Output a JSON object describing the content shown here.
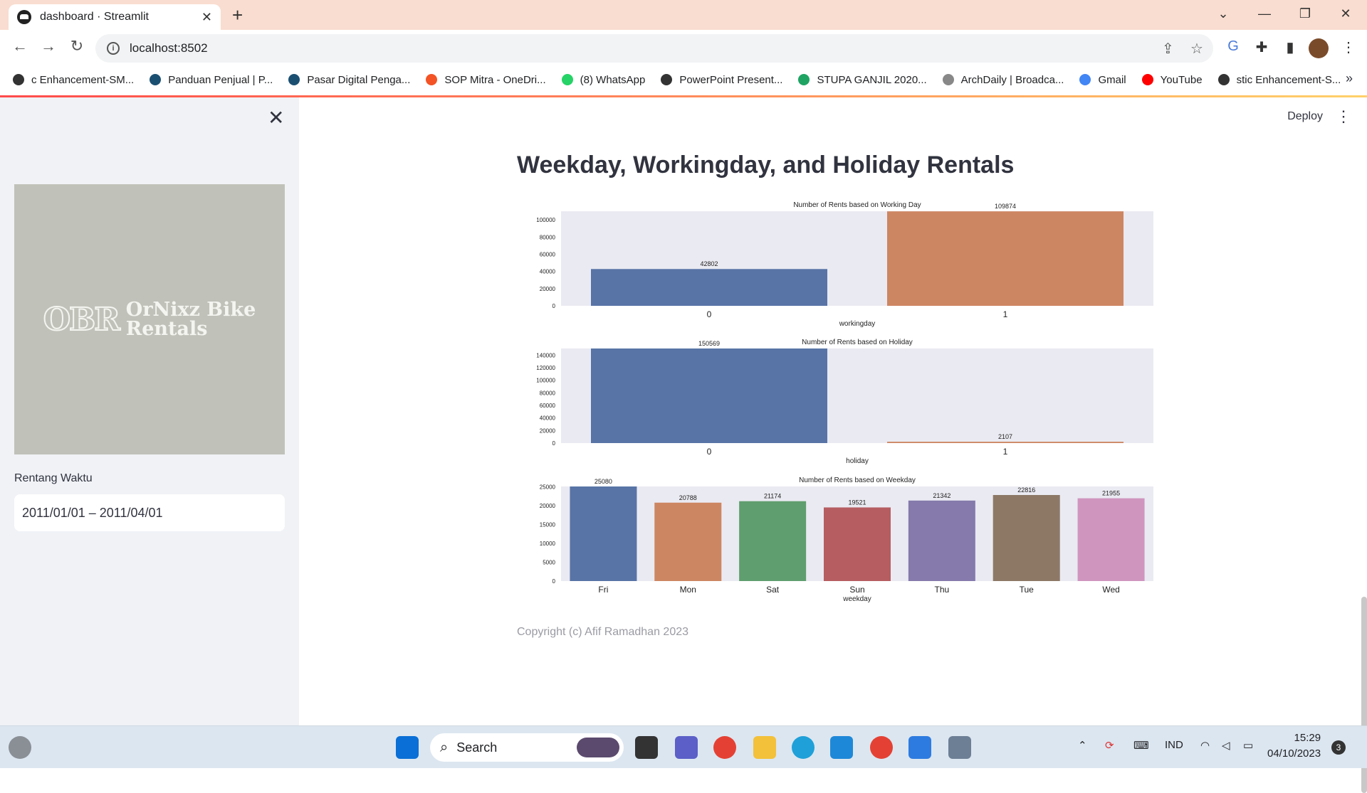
{
  "browser": {
    "tab_title": "dashboard · Streamlit",
    "url": "localhost:8502",
    "bookmarks": [
      {
        "label": "c Enhancement-SM...",
        "icon": "globe-icon",
        "color": "#333333"
      },
      {
        "label": "Panduan Penjual | P...",
        "icon": "shop-icon",
        "color": "#1b4f72"
      },
      {
        "label": "Pasar Digital Penga...",
        "icon": "shop-icon",
        "color": "#1b4f72"
      },
      {
        "label": "SOP Mitra - OneDri...",
        "icon": "microsoft-icon",
        "color": "#f35325"
      },
      {
        "label": "(8) WhatsApp",
        "icon": "whatsapp-icon",
        "color": "#25d366"
      },
      {
        "label": "PowerPoint Present...",
        "icon": "globe-icon",
        "color": "#333333"
      },
      {
        "label": "STUPA GANJIL 2020...",
        "icon": "drive-icon",
        "color": "#1fa463"
      },
      {
        "label": "ArchDaily | Broadca...",
        "icon": "archdaily-icon",
        "color": "#888888"
      },
      {
        "label": "Gmail",
        "icon": "google-icon",
        "color": "#4285f4"
      },
      {
        "label": "YouTube",
        "icon": "youtube-icon",
        "color": "#ff0000"
      },
      {
        "label": "stic Enhancement-S...",
        "icon": "globe-icon",
        "color": "#333333"
      }
    ],
    "more_bookmarks": "»"
  },
  "sidebar": {
    "logo_monogram": "OBR",
    "logo_name_line1": "OrNixz Bike",
    "logo_name_line2": "Rentals",
    "date_label": "Rentang Waktu",
    "date_value": "2011/01/01 – 2011/04/01"
  },
  "header": {
    "deploy_label": "Deploy"
  },
  "main": {
    "title": "Weekday, Workingday, and Holiday Rentals",
    "footer": "Copyright (c) Afif Ramadhan 2023"
  },
  "chart_data": [
    {
      "type": "bar",
      "title": "Number of Rents based on Working Day",
      "xlabel": "workingday",
      "ylabel": "",
      "categories": [
        "0",
        "1"
      ],
      "values": [
        42802,
        109874
      ],
      "colors": [
        "#5874a6",
        "#cd8662"
      ],
      "yticks": [
        0,
        20000,
        40000,
        60000,
        80000,
        100000
      ],
      "ylim": [
        0,
        110000
      ]
    },
    {
      "type": "bar",
      "title": "Number of Rents based on Holiday",
      "xlabel": "holiday",
      "ylabel": "",
      "categories": [
        "0",
        "1"
      ],
      "values": [
        150569,
        2107
      ],
      "colors": [
        "#5874a6",
        "#cd8662"
      ],
      "yticks": [
        0,
        20000,
        40000,
        60000,
        80000,
        100000,
        120000,
        140000
      ],
      "ylim": [
        0,
        150569
      ]
    },
    {
      "type": "bar",
      "title": "Number of Rents based on Weekday",
      "xlabel": "weekday",
      "ylabel": "",
      "categories": [
        "Fri",
        "Mon",
        "Sat",
        "Sun",
        "Thu",
        "Tue",
        "Wed"
      ],
      "values": [
        25080,
        20788,
        21174,
        19521,
        21342,
        22816,
        21955
      ],
      "colors": [
        "#5874a6",
        "#cd8662",
        "#5f9e6e",
        "#b65d61",
        "#857aab",
        "#8d7866",
        "#d095bf"
      ],
      "yticks": [
        0,
        5000,
        10000,
        15000,
        20000,
        25000
      ],
      "ylim": [
        0,
        25080
      ]
    }
  ],
  "taskbar": {
    "search_label": "Search",
    "lang": "IND",
    "time": "15:29",
    "date": "04/10/2023",
    "notifications": "3"
  }
}
